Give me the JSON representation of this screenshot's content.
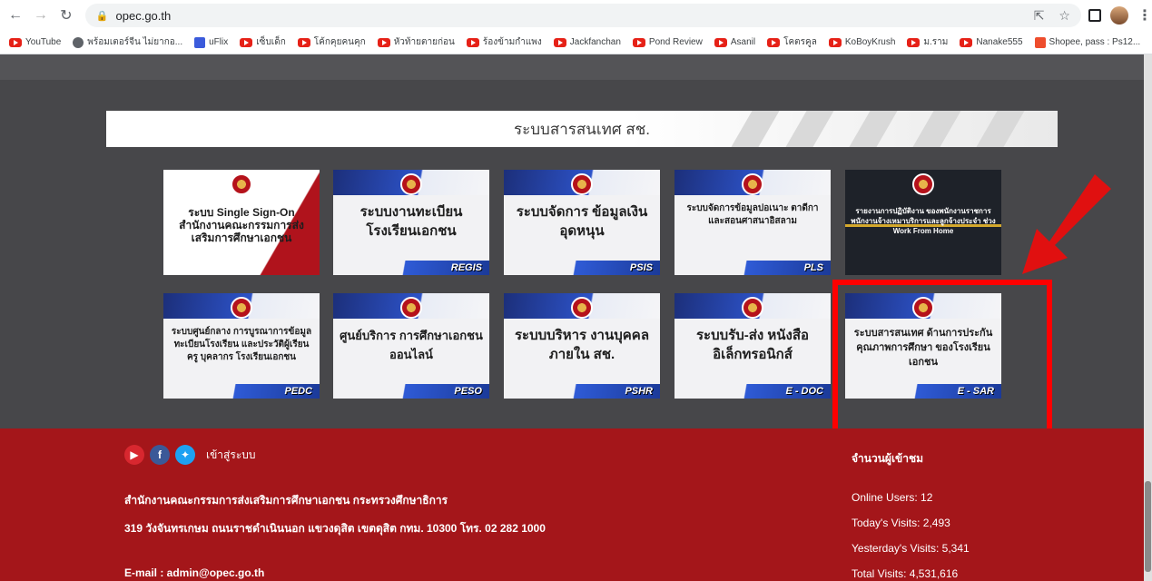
{
  "browser": {
    "url": "opec.go.th",
    "bookmarks": [
      {
        "label": "YouTube",
        "icon": "youtube"
      },
      {
        "label": "พร้อมเตอร์จีน ไม่ยากอ...",
        "icon": "globe"
      },
      {
        "label": "uFlix",
        "icon": "uflix"
      },
      {
        "label": "เซ็บเด็ก",
        "icon": "youtube"
      },
      {
        "label": "โค้กคุยคนคุก",
        "icon": "youtube"
      },
      {
        "label": "หัวท้ายตายก่อน",
        "icon": "youtube"
      },
      {
        "label": "ร้องข้ามกำแพง",
        "icon": "youtube"
      },
      {
        "label": "Jackfanchan",
        "icon": "youtube"
      },
      {
        "label": "Pond Review",
        "icon": "youtube"
      },
      {
        "label": "Asanil",
        "icon": "youtube"
      },
      {
        "label": "โคตรคูล",
        "icon": "youtube"
      },
      {
        "label": "KoBoyKrush",
        "icon": "youtube"
      },
      {
        "label": "ม.ราม",
        "icon": "youtube"
      },
      {
        "label": "Nanake555",
        "icon": "youtube"
      },
      {
        "label": "Shopee, pass : Ps12...",
        "icon": "shopee"
      }
    ],
    "more": "»"
  },
  "section": {
    "title": "ระบบสารสนเทศ สช."
  },
  "tiles": {
    "sso": {
      "title": "ระบบ Single Sign-On สำนักงานคณะกรรมการส่งเสริมการศึกษาเอกชน",
      "tag": ""
    },
    "regis": {
      "title": "ระบบงานทะเบียน โรงเรียนเอกชน",
      "tag": "REGIS"
    },
    "psis": {
      "title": "ระบบจัดการ ข้อมูลเงินอุดหนุน",
      "tag": "PSIS"
    },
    "pls": {
      "title": "ระบบจัดการข้อมูลปอเนาะ ตาดีกา และสอนศาสนาอิสลาม",
      "tag": "PLS"
    },
    "wfh": {
      "title": "รายงานการปฏิบัติงาน ของพนักงานราชการ พนักงานจ้างเหมาบริการและลูกจ้างประจำ ช่วง Work From Home",
      "tag": ""
    },
    "pedc": {
      "title": "ระบบศูนย์กลาง การบูรณาการข้อมูลทะเบียนโรงเรียน และประวัติผู้เรียน ครู บุคลากร โรงเรียนเอกชน",
      "tag": "PEDC"
    },
    "peso": {
      "title": "ศูนย์บริการ การศึกษาเอกชนออนไลน์",
      "tag": "PESO"
    },
    "pshr": {
      "title": "ระบบบริหาร งานบุคคลภายใน สช.",
      "tag": "PSHR"
    },
    "edoc": {
      "title": "ระบบรับ-ส่ง หนังสืออิเล็กทรอนิกส์",
      "tag": "E - DOC"
    },
    "esar": {
      "title": "ระบบสารสนเทศ ด้านการประกันคุณภาพการศึกษา ของโรงเรียนเอกชน",
      "tag": "E - SAR"
    }
  },
  "annotation_color": "#ff0000",
  "footer": {
    "login": "เข้าสู่ระบบ",
    "org": "สำนักงานคณะกรรมการส่งเสริมการศึกษาเอกชน กระทรวงศึกษาธิการ",
    "address": "319 วังจันทรเกษม ถนนราชดำเนินนอก แขวงดุสิต เขตดุสิต กทม. 10300 โทร. 02 282 1000",
    "email": "E-mail : admin@opec.go.th",
    "stats_title": "จำนวนผู้เข้าชม",
    "online": "Online Users: 12",
    "today": "Today's Visits: 2,493",
    "yesterday": "Yesterday's Visits: 5,341",
    "total": "Total Visits: 4,531,616"
  }
}
